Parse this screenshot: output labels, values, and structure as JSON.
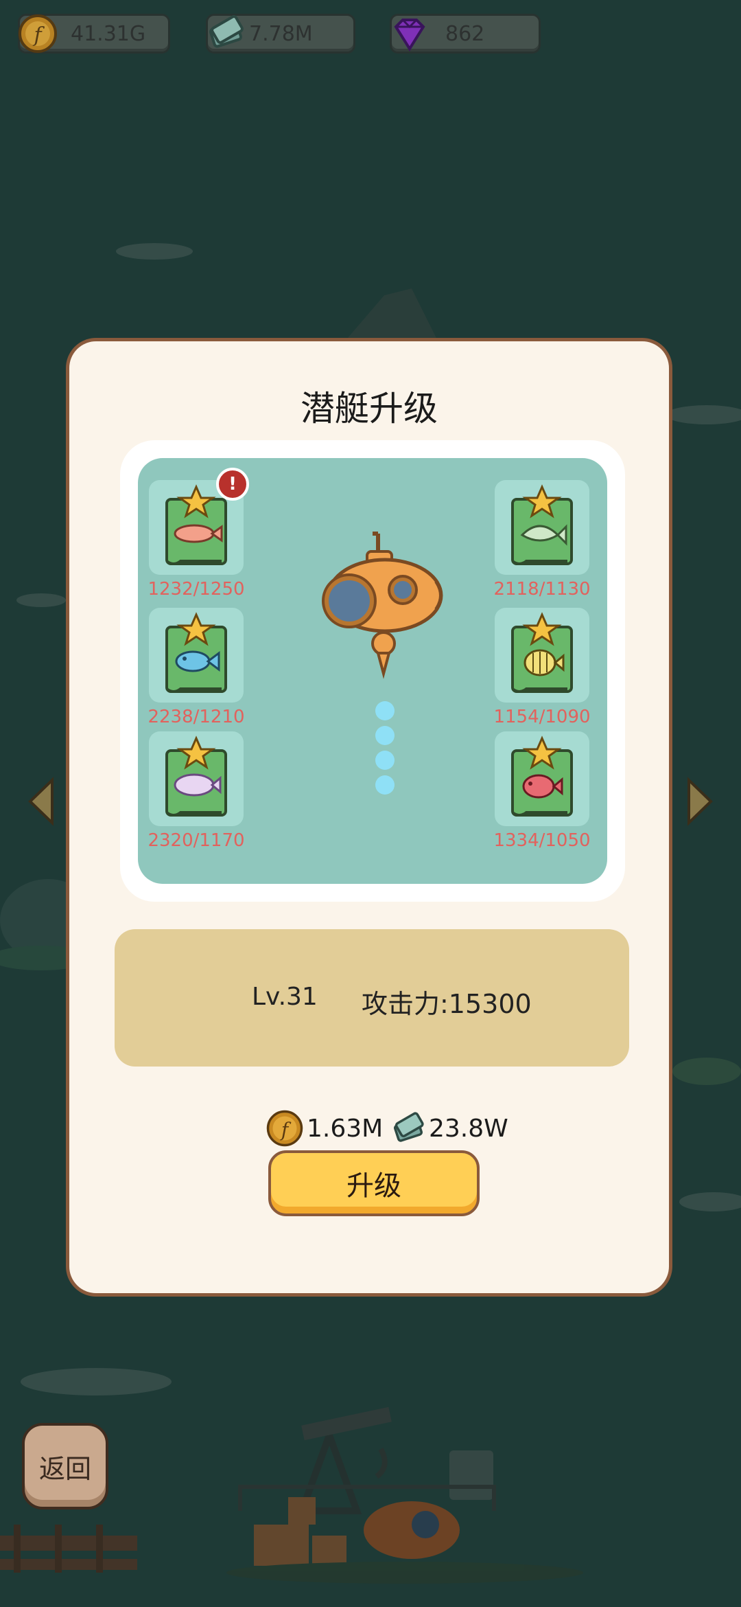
{
  "top_bar": {
    "gold": "41.31G",
    "books": "7.78M",
    "gems": "862"
  },
  "dialog": {
    "title": "潜艇升级",
    "fish_cards": [
      {
        "count": "1232/1250",
        "alert": "!"
      },
      {
        "count": "2238/1210"
      },
      {
        "count": "2320/1170"
      },
      {
        "count": "2118/1130"
      },
      {
        "count": "1154/1090"
      },
      {
        "count": "1334/1050"
      }
    ],
    "level": "Lv.31",
    "attack": "攻击力:15300",
    "cost_gold": "1.63M",
    "cost_books": "23.8W",
    "upgrade_label": "升级"
  },
  "back_label": "返回",
  "colors": {
    "background": "#1e3a36",
    "dialog": "#fbf4ea",
    "dialog_border": "#8a5a3c",
    "panel": "#8fc7bd",
    "count_text": "#e2625d",
    "stats_box": "#e2cd97",
    "upgrade_button": "#ffcf55"
  }
}
